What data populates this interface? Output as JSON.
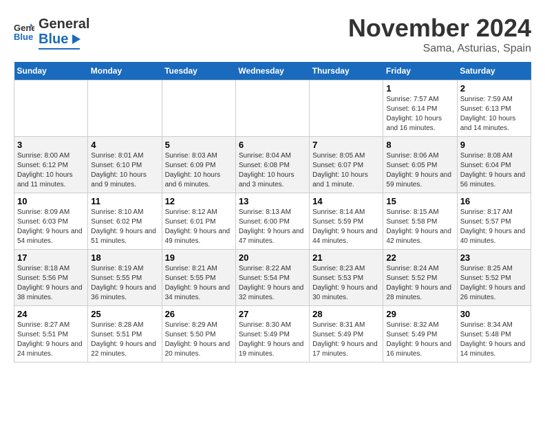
{
  "header": {
    "logo_line1": "General",
    "logo_line2": "Blue",
    "title": "November 2024",
    "subtitle": "Sama, Asturias, Spain"
  },
  "weekdays": [
    "Sunday",
    "Monday",
    "Tuesday",
    "Wednesday",
    "Thursday",
    "Friday",
    "Saturday"
  ],
  "weeks": [
    [
      {
        "day": "",
        "content": ""
      },
      {
        "day": "",
        "content": ""
      },
      {
        "day": "",
        "content": ""
      },
      {
        "day": "",
        "content": ""
      },
      {
        "day": "",
        "content": ""
      },
      {
        "day": "1",
        "content": "Sunrise: 7:57 AM\nSunset: 6:14 PM\nDaylight: 10 hours and 16 minutes."
      },
      {
        "day": "2",
        "content": "Sunrise: 7:59 AM\nSunset: 6:13 PM\nDaylight: 10 hours and 14 minutes."
      }
    ],
    [
      {
        "day": "3",
        "content": "Sunrise: 8:00 AM\nSunset: 6:12 PM\nDaylight: 10 hours and 11 minutes."
      },
      {
        "day": "4",
        "content": "Sunrise: 8:01 AM\nSunset: 6:10 PM\nDaylight: 10 hours and 9 minutes."
      },
      {
        "day": "5",
        "content": "Sunrise: 8:03 AM\nSunset: 6:09 PM\nDaylight: 10 hours and 6 minutes."
      },
      {
        "day": "6",
        "content": "Sunrise: 8:04 AM\nSunset: 6:08 PM\nDaylight: 10 hours and 3 minutes."
      },
      {
        "day": "7",
        "content": "Sunrise: 8:05 AM\nSunset: 6:07 PM\nDaylight: 10 hours and 1 minute."
      },
      {
        "day": "8",
        "content": "Sunrise: 8:06 AM\nSunset: 6:05 PM\nDaylight: 9 hours and 59 minutes."
      },
      {
        "day": "9",
        "content": "Sunrise: 8:08 AM\nSunset: 6:04 PM\nDaylight: 9 hours and 56 minutes."
      }
    ],
    [
      {
        "day": "10",
        "content": "Sunrise: 8:09 AM\nSunset: 6:03 PM\nDaylight: 9 hours and 54 minutes."
      },
      {
        "day": "11",
        "content": "Sunrise: 8:10 AM\nSunset: 6:02 PM\nDaylight: 9 hours and 51 minutes."
      },
      {
        "day": "12",
        "content": "Sunrise: 8:12 AM\nSunset: 6:01 PM\nDaylight: 9 hours and 49 minutes."
      },
      {
        "day": "13",
        "content": "Sunrise: 8:13 AM\nSunset: 6:00 PM\nDaylight: 9 hours and 47 minutes."
      },
      {
        "day": "14",
        "content": "Sunrise: 8:14 AM\nSunset: 5:59 PM\nDaylight: 9 hours and 44 minutes."
      },
      {
        "day": "15",
        "content": "Sunrise: 8:15 AM\nSunset: 5:58 PM\nDaylight: 9 hours and 42 minutes."
      },
      {
        "day": "16",
        "content": "Sunrise: 8:17 AM\nSunset: 5:57 PM\nDaylight: 9 hours and 40 minutes."
      }
    ],
    [
      {
        "day": "17",
        "content": "Sunrise: 8:18 AM\nSunset: 5:56 PM\nDaylight: 9 hours and 38 minutes."
      },
      {
        "day": "18",
        "content": "Sunrise: 8:19 AM\nSunset: 5:55 PM\nDaylight: 9 hours and 36 minutes."
      },
      {
        "day": "19",
        "content": "Sunrise: 8:21 AM\nSunset: 5:55 PM\nDaylight: 9 hours and 34 minutes."
      },
      {
        "day": "20",
        "content": "Sunrise: 8:22 AM\nSunset: 5:54 PM\nDaylight: 9 hours and 32 minutes."
      },
      {
        "day": "21",
        "content": "Sunrise: 8:23 AM\nSunset: 5:53 PM\nDaylight: 9 hours and 30 minutes."
      },
      {
        "day": "22",
        "content": "Sunrise: 8:24 AM\nSunset: 5:52 PM\nDaylight: 9 hours and 28 minutes."
      },
      {
        "day": "23",
        "content": "Sunrise: 8:25 AM\nSunset: 5:52 PM\nDaylight: 9 hours and 26 minutes."
      }
    ],
    [
      {
        "day": "24",
        "content": "Sunrise: 8:27 AM\nSunset: 5:51 PM\nDaylight: 9 hours and 24 minutes."
      },
      {
        "day": "25",
        "content": "Sunrise: 8:28 AM\nSunset: 5:51 PM\nDaylight: 9 hours and 22 minutes."
      },
      {
        "day": "26",
        "content": "Sunrise: 8:29 AM\nSunset: 5:50 PM\nDaylight: 9 hours and 20 minutes."
      },
      {
        "day": "27",
        "content": "Sunrise: 8:30 AM\nSunset: 5:49 PM\nDaylight: 9 hours and 19 minutes."
      },
      {
        "day": "28",
        "content": "Sunrise: 8:31 AM\nSunset: 5:49 PM\nDaylight: 9 hours and 17 minutes."
      },
      {
        "day": "29",
        "content": "Sunrise: 8:32 AM\nSunset: 5:49 PM\nDaylight: 9 hours and 16 minutes."
      },
      {
        "day": "30",
        "content": "Sunrise: 8:34 AM\nSunset: 5:48 PM\nDaylight: 9 hours and 14 minutes."
      }
    ]
  ]
}
